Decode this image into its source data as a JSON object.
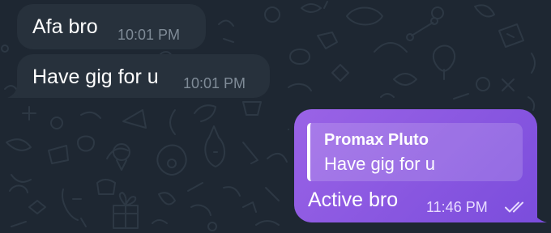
{
  "chat": {
    "messages": [
      {
        "direction": "incoming",
        "text": "Afa bro",
        "time": "10:01 PM"
      },
      {
        "direction": "incoming",
        "text": "Have gig for u",
        "time": "10:01 PM"
      },
      {
        "direction": "outgoing",
        "reply_to": {
          "sender": "Promax Pluto",
          "text": "Have gig for u"
        },
        "text": "Active bro",
        "time": "11:46 PM",
        "status_icon": "double-check-icon"
      }
    ]
  },
  "colors": {
    "background": "#1e2732",
    "incoming_bubble": "#27313c",
    "outgoing_bubble_start": "#9a63e6",
    "outgoing_bubble_end": "#7b4ddc",
    "incoming_time": "#7f8b97",
    "outgoing_time": "#e8dcff"
  },
  "background_pattern_icon": "doodle-wallpaper-pattern"
}
